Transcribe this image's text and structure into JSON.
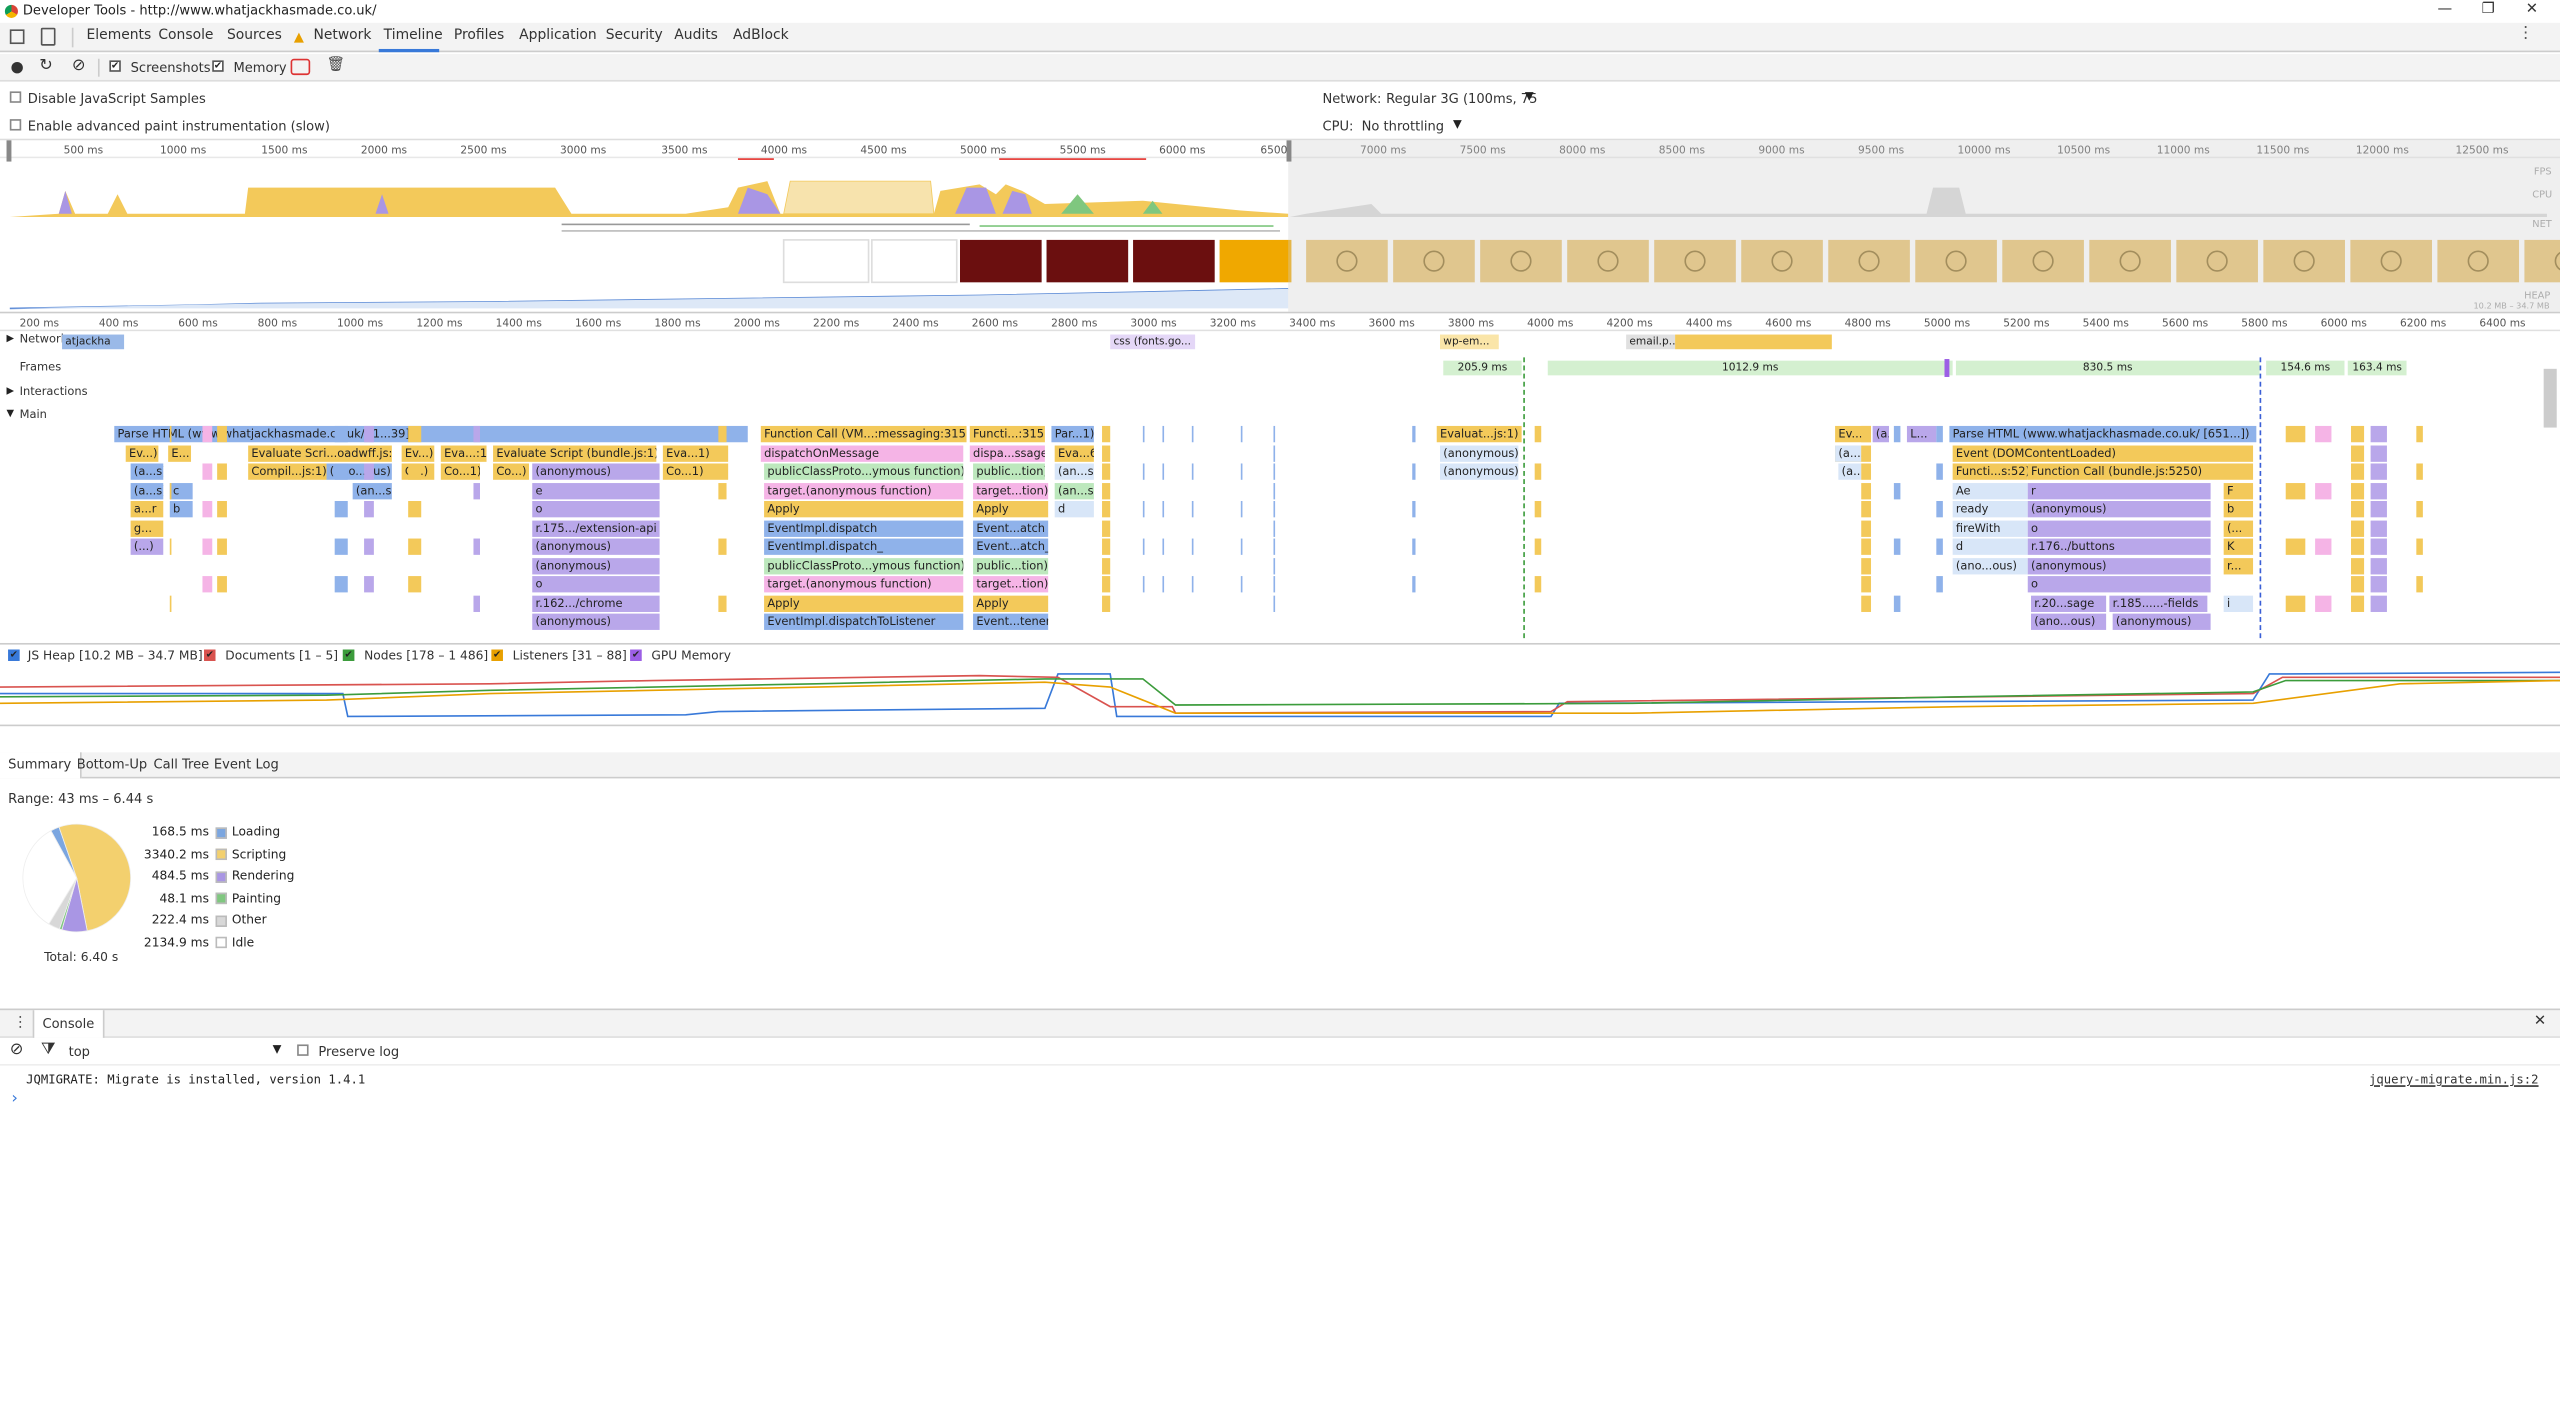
{
  "window": {
    "title": "Developer Tools - http://www.whatjackhasmade.co.uk/"
  },
  "tabs": {
    "elements": "Elements",
    "console": "Console",
    "sources": "Sources",
    "network": "Network",
    "timeline": "Timeline",
    "profiles": "Profiles",
    "application": "Application",
    "security": "Security",
    "audits": "Audits",
    "adblock": "AdBlock"
  },
  "toolbar": {
    "screenshots": "Screenshots",
    "memory": "Memory"
  },
  "settings": {
    "disable_js": "Disable JavaScript Samples",
    "advanced_paint": "Enable advanced paint instrumentation (slow)",
    "network_label": "Network:",
    "network_value": "Regular 3G (100ms, 75",
    "cpu_label": "CPU:",
    "cpu_value": "No throttling"
  },
  "overview": {
    "ticks": [
      "500 ms",
      "1000 ms",
      "1500 ms",
      "2000 ms",
      "2500 ms",
      "3000 ms",
      "3500 ms",
      "4000 ms",
      "4500 ms",
      "5000 ms",
      "5500 ms",
      "6000 ms",
      "6500",
      "7000 ms",
      "7500 ms",
      "8000 ms",
      "8500 ms",
      "9000 ms",
      "9500 ms",
      "10000 ms",
      "10500 ms",
      "11000 ms",
      "11500 ms",
      "12000 ms",
      "12500 ms"
    ],
    "labels": {
      "fps": "FPS",
      "cpu": "CPU",
      "net": "NET",
      "heap": "HEAP",
      "heap_range": "10.2 MB – 34.7 MB"
    }
  },
  "ruler": {
    "ticks": [
      "200 ms",
      "400 ms",
      "600 ms",
      "800 ms",
      "1000 ms",
      "1200 ms",
      "1400 ms",
      "1600 ms",
      "1800 ms",
      "2000 ms",
      "2200 ms",
      "2400 ms",
      "2600 ms",
      "2800 ms",
      "3000 ms",
      "3200 ms",
      "3400 ms",
      "3600 ms",
      "3800 ms",
      "4000 ms",
      "4200 ms",
      "4400 ms",
      "4600 ms",
      "4800 ms",
      "5000 ms",
      "5200 ms",
      "5400 ms",
      "5600 ms",
      "5800 ms",
      "6000 ms",
      "6200 ms",
      "6400 ms"
    ]
  },
  "tracks": {
    "network": "Network",
    "network_item": "atjackha",
    "net_css": "css (fonts.go...",
    "net_wp": "wp-em...",
    "net_email": "email.p...",
    "frames": "Frames",
    "frame_vals": [
      "205.9 ms",
      "1012.9 ms",
      "830.5 ms",
      "154.6 ms",
      "163.4 ms"
    ],
    "interactions": "Interactions",
    "main": "Main"
  },
  "flame": {
    "row0": [
      "Parse HTML (www.whatjackhasmade.co.uk/ [1...39])",
      "Function Call (VM...:messaging:315)",
      "Functi...:315)",
      "Par...1)",
      "Evaluat...js:1)",
      "Ev...)",
      "(a...)",
      "L...",
      "Parse HTML (www.whatjackhasmade.co.uk/ [651...])"
    ],
    "row1": [
      "Ev...)",
      "E...",
      "Evaluate Scri...oadwff.js:1)",
      "Ev...)",
      "Eva...:1)",
      "Evaluate Script (bundle.js:1)",
      "Eva...1)",
      "dispatchOnMessage",
      "dispa...ssage",
      "Eva...6)",
      "(anonymous)",
      "Ev...",
      "(a...)",
      "Event (DOMContentLoaded)"
    ],
    "row2": [
      "(a...s)",
      "Compil...js:1)",
      "(ano...ous)",
      "C...)",
      "Co...1)",
      "Co...)",
      "(anonymous)",
      "Co...1)",
      "publicClassProto...ymous function)",
      "public...tion)",
      "(an...s)",
      "(anonymous)",
      "(a...)",
      "Functi...s:52)",
      "Function Call (bundle.js:5250)"
    ],
    "row3": [
      "(a...s)",
      "c",
      "(an...s)",
      "e",
      "target.(anonymous function)",
      "target...tion)",
      "(an...s)",
      "Ae",
      "r",
      "F"
    ],
    "row4": [
      "a...r",
      "b",
      "o",
      "Apply",
      "Apply",
      "d",
      "ready",
      "(anonymous)",
      "b"
    ],
    "row5": [
      "g...",
      "r.175.../extension-api",
      "EventImpl.dispatch",
      "Event...atch",
      "fireWith",
      "o",
      "(..."
    ],
    "row6": [
      "(...)",
      "(anonymous)",
      "EventImpl.dispatch_",
      "Event...atch_",
      "d",
      "r.176../buttons",
      "K"
    ],
    "row7": [
      "(anonymous)",
      "publicClassProto...ymous function)",
      "public...tion)",
      "(ano...ous)",
      "(anonymous)",
      "r..."
    ],
    "row8": [
      "o",
      "target.(anonymous function)",
      "target...tion)",
      "o"
    ],
    "row9": [
      "r.162.../chrome",
      "Apply",
      "Apply",
      "r.20...sage",
      "r.185......-fields",
      "i"
    ],
    "row10": [
      "(anonymous)",
      "EventImpl.dispatchToListener",
      "Event...tener",
      "(ano...ous)",
      "(anonymous)"
    ]
  },
  "memory": {
    "js_heap": "JS Heap [10.2 MB – 34.7 MB]",
    "documents": "Documents [1 – 5]",
    "nodes": "Nodes [178 – 1 486]",
    "listeners": "Listeners [31 – 88]",
    "gpu": "GPU Memory"
  },
  "subtabs": {
    "summary": "Summary",
    "bottom_up": "Bottom-Up",
    "call_tree": "Call Tree",
    "event_log": "Event Log"
  },
  "summary": {
    "range": "Range: 43 ms – 6.44 s",
    "total": "Total: 6.40 s",
    "items": [
      {
        "value": "168.5 ms",
        "label": "Loading",
        "color": "#7ba6e0"
      },
      {
        "value": "3340.2 ms",
        "label": "Scripting",
        "color": "#f3d06e"
      },
      {
        "value": "484.5 ms",
        "label": "Rendering",
        "color": "#a996e4"
      },
      {
        "value": "48.1 ms",
        "label": "Painting",
        "color": "#7fc77f"
      },
      {
        "value": "222.4 ms",
        "label": "Other",
        "color": "#d8d8d8"
      },
      {
        "value": "2134.9 ms",
        "label": "Idle",
        "color": "#ffffff"
      }
    ]
  },
  "console": {
    "tab": "Console",
    "context": "top",
    "preserve": "Preserve log",
    "message": "JQMIGRATE: Migrate is installed, version 1.4.1",
    "source": "jquery-migrate.min.js:2",
    "prompt": "›"
  },
  "colors": {
    "accent": "#3879d9",
    "scripting": "#f3c95a",
    "rendering": "#a996e4",
    "loading": "#7ba6e0",
    "painting": "#7fc77f"
  }
}
